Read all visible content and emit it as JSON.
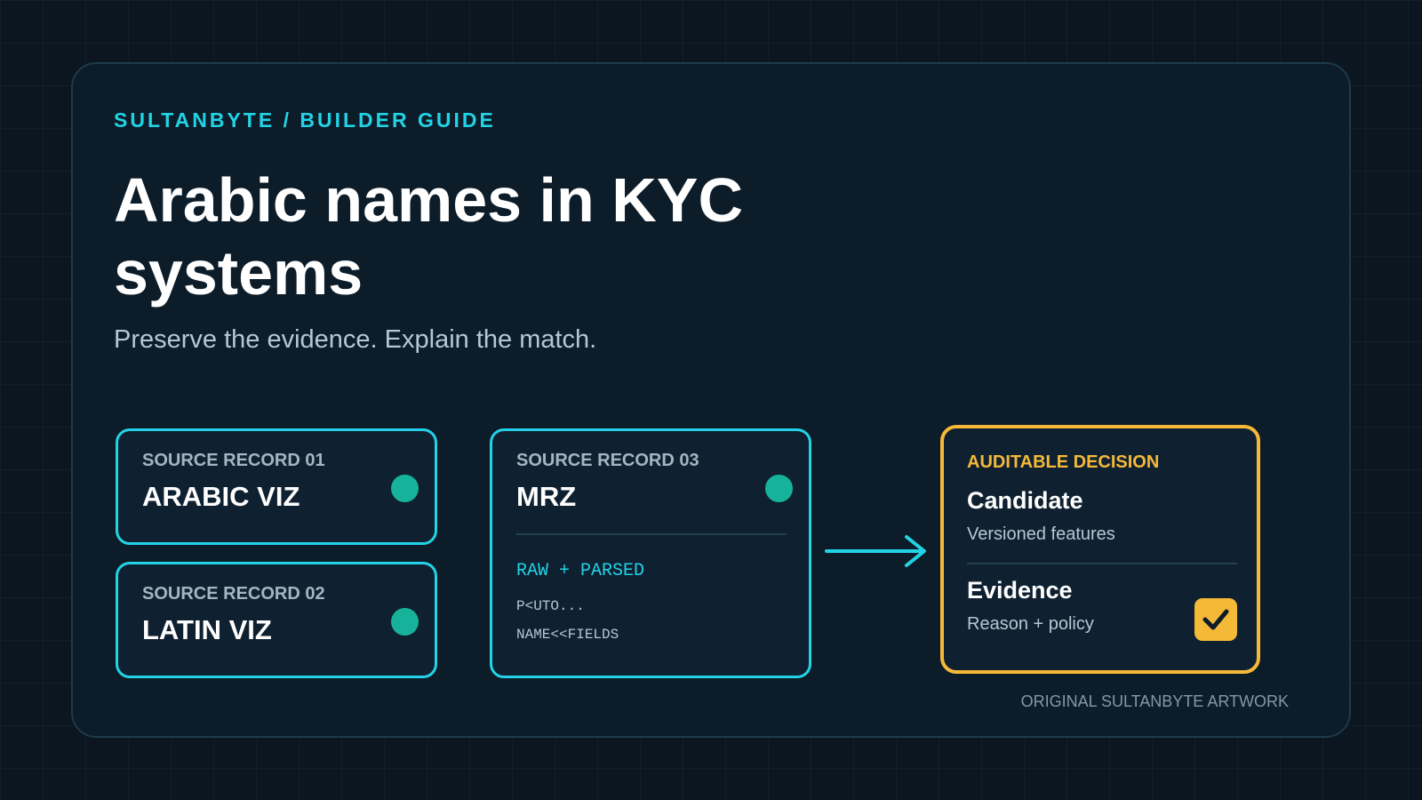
{
  "header": {
    "eyebrow": "SULTANBYTE / BUILDER GUIDE",
    "title": "Arabic names in KYC systems",
    "subtitle": "Preserve the evidence. Explain the match."
  },
  "sources": [
    {
      "label": "SOURCE RECORD 01",
      "value": "ARABIC VIZ"
    },
    {
      "label": "SOURCE RECORD 02",
      "value": "LATIN VIZ"
    },
    {
      "label": "SOURCE RECORD 03",
      "value": "MRZ",
      "mode": "RAW + PARSED",
      "lines": [
        "P<UTO...",
        "NAME<<FIELDS"
      ]
    }
  ],
  "decision": {
    "label": "AUDITABLE DECISION",
    "candidate_title": "Candidate",
    "candidate_desc": "Versioned features",
    "evidence_title": "Evidence",
    "evidence_desc": "Reason + policy"
  },
  "footer": "ORIGINAL SULTANBYTE ARTWORK",
  "colors": {
    "accent_cyan": "#22d3e6",
    "accent_amber": "#f5b938",
    "status_green": "#16b39a",
    "background": "#0b1620",
    "panel": "#0c1c29"
  },
  "icons": [
    "status-dot-icon",
    "arrow-right-icon",
    "checkmark-icon"
  ]
}
